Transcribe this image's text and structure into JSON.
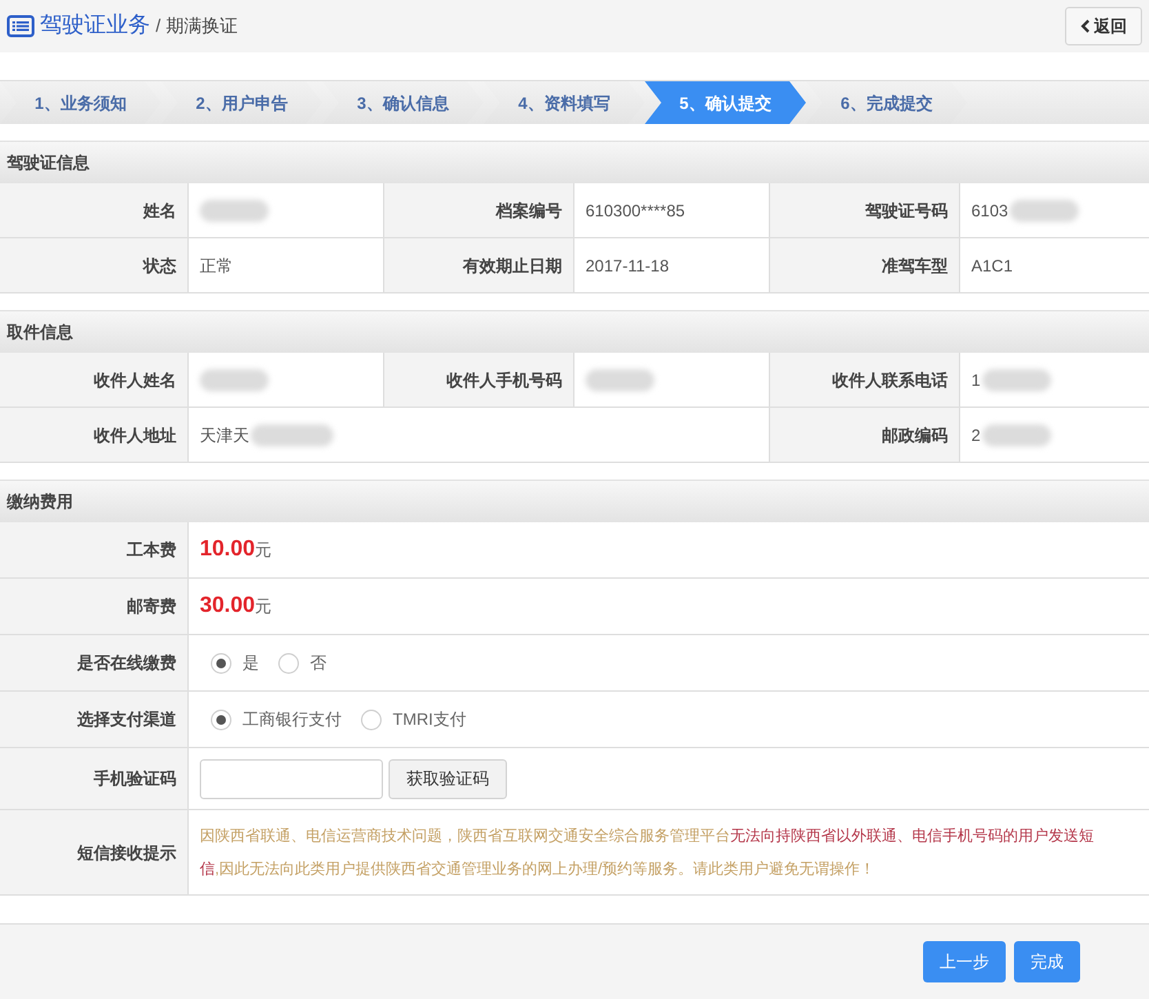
{
  "header": {
    "title": "驾驶证业务",
    "separator": "/",
    "subtitle": "期满换证",
    "back_button": "返回"
  },
  "steps": [
    {
      "label": "1、业务须知",
      "selected": false
    },
    {
      "label": "2、用户申告",
      "selected": false
    },
    {
      "label": "3、确认信息",
      "selected": false
    },
    {
      "label": "4、资料填写",
      "selected": false
    },
    {
      "label": "5、确认提交",
      "selected": true
    },
    {
      "label": "6、完成提交",
      "selected": false
    }
  ],
  "license_info": {
    "title": "驾驶证信息",
    "rows": [
      [
        {
          "label": "姓名",
          "redacted": true
        },
        {
          "label": "档案编号",
          "value": "610300****85",
          "redacted": false
        },
        {
          "label": "驾驶证号码",
          "value": "6103",
          "redacted": true
        }
      ],
      [
        {
          "label": "状态",
          "value": "正常",
          "redacted": false
        },
        {
          "label": "有效期止日期",
          "value": "2017-11-18",
          "redacted": false
        },
        {
          "label": "准驾车型",
          "value": "A1C1",
          "redacted": false
        }
      ]
    ]
  },
  "pickup_info": {
    "title": "取件信息",
    "rows": [
      [
        {
          "label": "收件人姓名",
          "redacted": true
        },
        {
          "label": "收件人手机号码",
          "redacted": true
        },
        {
          "label": "收件人联系电话",
          "value": "1",
          "redacted": true
        }
      ],
      [
        {
          "label": "收件人地址",
          "value": "天津天",
          "redacted": true
        },
        "",
        {
          "label": "邮政编码",
          "value": "2",
          "redacted": true
        }
      ]
    ]
  },
  "fees": {
    "title": "缴纳费用",
    "rows": [
      {
        "kind": "amount",
        "label": "工本费",
        "amount": "10.00",
        "unit": "元"
      },
      {
        "kind": "amount",
        "label": "邮寄费",
        "amount": "30.00",
        "unit": "元"
      },
      {
        "kind": "radio",
        "label": "是否在线缴费",
        "options": [
          {
            "label": "是",
            "selected": true
          },
          {
            "label": "否",
            "selected": false
          }
        ]
      },
      {
        "kind": "radio",
        "label": "选择支付渠道",
        "options": [
          {
            "label": "工商银行支付",
            "selected": true
          },
          {
            "label": "TMRI支付",
            "selected": false
          }
        ]
      },
      {
        "kind": "code",
        "label": "手机验证码",
        "button": "获取验证码"
      },
      {
        "kind": "notice",
        "label": "短信接收提示",
        "segments": [
          {
            "text": "因陕西省联通、电信运营商技术问题，陕西省互联网交通安全综合服务管理平台",
            "emphasis": false
          },
          {
            "text": "无法向持陕西省以外联通、电信手机号码的用户发送短",
            "emphasis": true
          },
          {
            "text": "信",
            "emphasis": true
          },
          {
            "text": ",因此无法向此类用户提供陕西省交通管理业务的网上办理/预约等服务。请此类用户避免无谓操作！",
            "emphasis": false
          }
        ]
      }
    ]
  },
  "footer_buttons": [
    "上一步",
    "完成"
  ]
}
